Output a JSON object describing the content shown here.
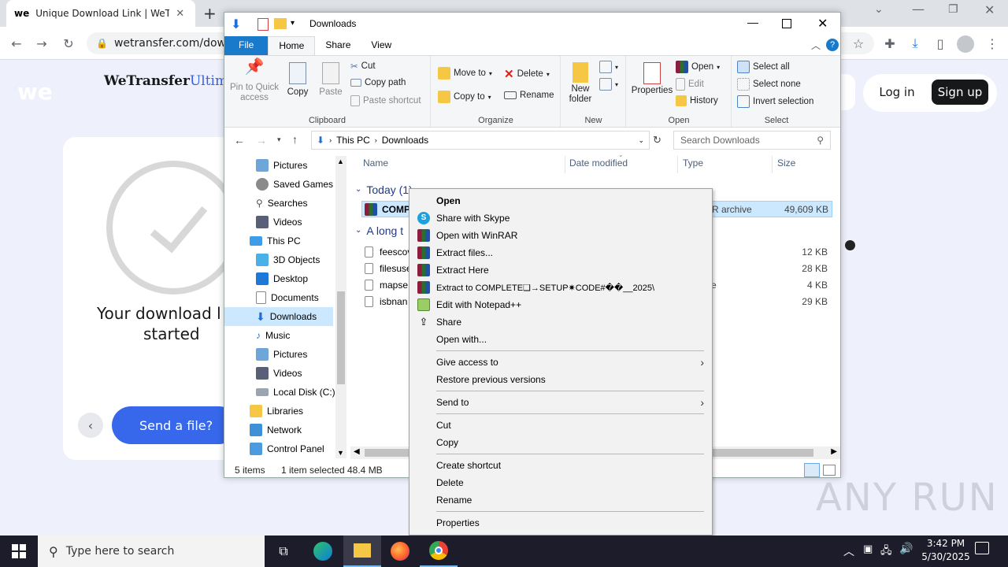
{
  "browser": {
    "tab_title": "Unique Download Link | WeTran",
    "url": "wetransfer.com/downlo",
    "new_tab": "+"
  },
  "wetransfer": {
    "logo": "WeTransfer",
    "logo_suffix": "Ultim",
    "status_line1": "Your download l",
    "status_line2": "started",
    "send_button": "Send a file?",
    "login": "Log in",
    "signup": "Sign up"
  },
  "explorer": {
    "title": "Downloads",
    "tabs": [
      "File",
      "Home",
      "Share",
      "View"
    ],
    "ribbon": {
      "clipboard": {
        "label": "Clipboard",
        "pin": "Pin to Quick access",
        "copy": "Copy",
        "paste": "Paste",
        "cut": "Cut",
        "copy_path": "Copy path",
        "paste_shortcut": "Paste shortcut"
      },
      "organize": {
        "label": "Organize",
        "move_to": "Move to",
        "copy_to": "Copy to",
        "delete": "Delete",
        "rename": "Rename"
      },
      "new": {
        "label": "New",
        "new_folder": "New folder"
      },
      "open": {
        "label": "Open",
        "properties": "Properties",
        "open": "Open",
        "edit": "Edit",
        "history": "History"
      },
      "select": {
        "label": "Select",
        "select_all": "Select all",
        "select_none": "Select none",
        "invert": "Invert selection"
      }
    },
    "address": {
      "this_pc": "This PC",
      "downloads": "Downloads"
    },
    "search_placeholder": "Search Downloads",
    "nav": [
      "Pictures",
      "Saved Games",
      "Searches",
      "Videos",
      "This PC",
      "3D Objects",
      "Desktop",
      "Documents",
      "Downloads",
      "Music",
      "Pictures",
      "Videos",
      "Local Disk (C:)",
      "Libraries",
      "Network",
      "Control Panel"
    ],
    "columns": {
      "name": "Name",
      "date": "Date modified",
      "type": "Type",
      "size": "Size"
    },
    "groups": {
      "today": "Today (1)",
      "long_ago": "A long t"
    },
    "files": [
      {
        "name": "COMPL",
        "type": "R archive",
        "size": "49,609 KB"
      },
      {
        "name": "feescov",
        "type": "",
        "size": "12 KB"
      },
      {
        "name": "filesuse",
        "type": "",
        "size": "28 KB"
      },
      {
        "name": "mapse",
        "type": "e",
        "size": "4 KB"
      },
      {
        "name": "isbnan",
        "type": "",
        "size": "29 KB"
      }
    ],
    "status": {
      "items": "5 items",
      "selected": "1 item selected",
      "size": "48.4 MB"
    }
  },
  "context_menu": {
    "items": [
      {
        "label": "Open",
        "bold": true
      },
      {
        "label": "Share with Skype"
      },
      {
        "label": "Open with WinRAR"
      },
      {
        "label": "Extract files..."
      },
      {
        "label": "Extract Here"
      },
      {
        "label": "Extract to COMPLETE❑→SETUP✷CODE#��__2025\\"
      },
      {
        "label": "Edit with Notepad++"
      },
      {
        "label": "Share"
      },
      {
        "label": "Open with..."
      },
      {
        "label": "Give access to"
      },
      {
        "label": "Restore previous versions"
      },
      {
        "label": "Send to"
      },
      {
        "label": "Cut"
      },
      {
        "label": "Copy"
      },
      {
        "label": "Create shortcut"
      },
      {
        "label": "Delete"
      },
      {
        "label": "Rename"
      },
      {
        "label": "Properties"
      }
    ]
  },
  "taskbar": {
    "search_placeholder": "Type here to search",
    "time": "3:42 PM",
    "date": "5/30/2025"
  },
  "watermark": "ANY RUN"
}
